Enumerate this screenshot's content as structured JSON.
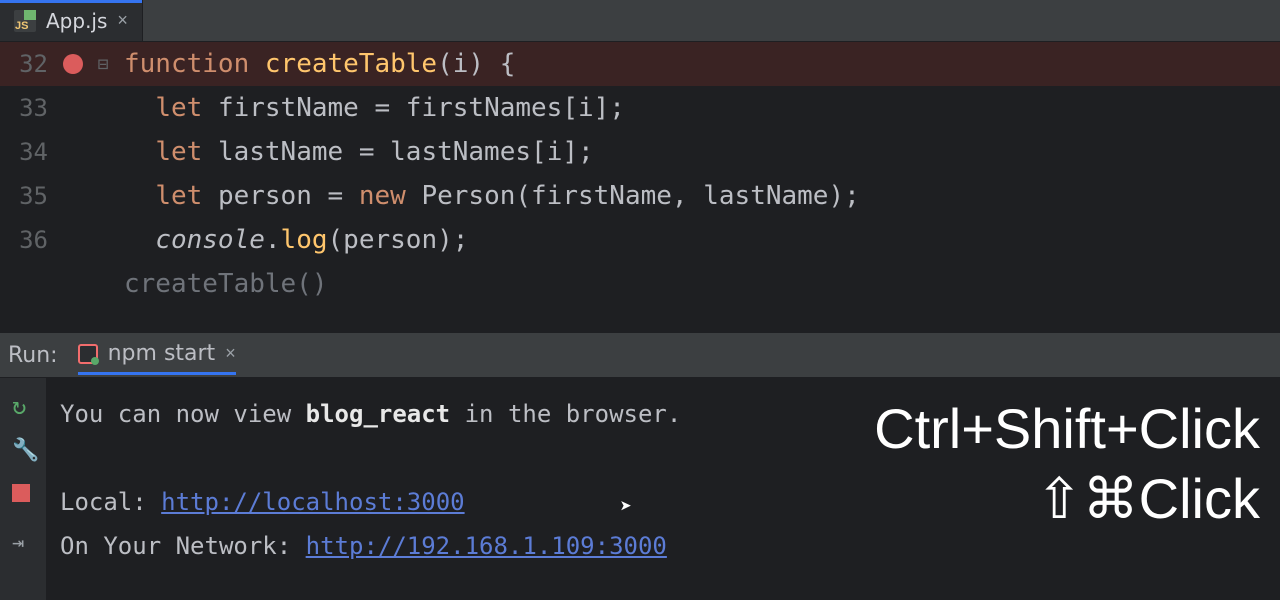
{
  "tab": {
    "filename": "App.js"
  },
  "editor": {
    "lines": [
      {
        "num": "32",
        "kind": "bp"
      },
      {
        "num": "33"
      },
      {
        "num": "34"
      },
      {
        "num": "35"
      },
      {
        "num": "36"
      }
    ],
    "code": {
      "kw_function": "function",
      "fn_name": "createTable",
      "param": "i",
      "kw_let": "let",
      "var_firstName": "firstName",
      "arr_firstNames": "firstNames",
      "var_lastName": "lastName",
      "arr_lastNames": "lastNames",
      "var_person": "person",
      "kw_new": "new",
      "cls_person": "Person",
      "console": "console",
      "log": "log"
    },
    "hint": "createTable()"
  },
  "run": {
    "label": "Run:",
    "tab_label": "npm start",
    "line1_pre": "You can now view ",
    "line1_bold": "blog_react",
    "line1_post": " in the browser.",
    "local_label": "Local:",
    "local_url": "http://localhost:3000",
    "net_label": "On Your Network:",
    "net_url": "http://192.168.1.109:3000"
  },
  "overlay": {
    "win": "Ctrl+Shift+Click",
    "mac": "⇧⌘Click"
  }
}
